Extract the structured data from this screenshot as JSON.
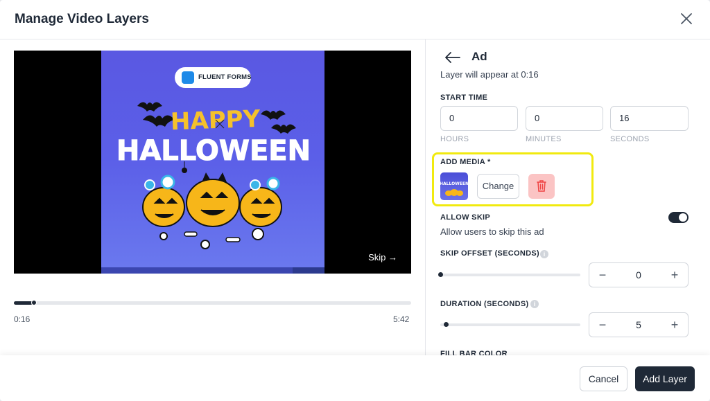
{
  "modal": {
    "title": "Manage Video Layers"
  },
  "player": {
    "brand_text": "FLUENT FORMS",
    "skip_label": "Skip →",
    "current_time": "0:16",
    "total_time": "5:42",
    "progress": 0.047
  },
  "panel": {
    "back_title": "Ad",
    "appear_text": "Layer will appear at 0:16",
    "start_time": {
      "label": "START TIME",
      "hours_value": "0",
      "minutes_value": "0",
      "seconds_value": "16",
      "hours_label": "HOURS",
      "minutes_label": "MINUTES",
      "seconds_label": "SECONDS"
    },
    "media": {
      "label": "ADD MEDIA *",
      "change_label": "Change"
    },
    "allow_skip": {
      "label": "ALLOW SKIP",
      "description": "Allow users to skip this ad",
      "enabled": true
    },
    "skip_offset": {
      "label": "SKIP OFFSET (SECONDS)",
      "value": "0",
      "minus": "−",
      "plus": "+"
    },
    "duration": {
      "label": "DURATION (SECONDS)",
      "value": "5",
      "minus": "−",
      "plus": "+"
    },
    "fill_bar_color": {
      "label": "FILL BAR COLOR"
    }
  },
  "footer": {
    "cancel_label": "Cancel",
    "add_label": "Add Layer"
  },
  "colors": {
    "accent": "#1f2937",
    "highlight": "#f1ea0f",
    "danger_bg": "#fbc4c4",
    "danger_icon": "#ef4444",
    "video_bg": "#5b5fe8"
  }
}
